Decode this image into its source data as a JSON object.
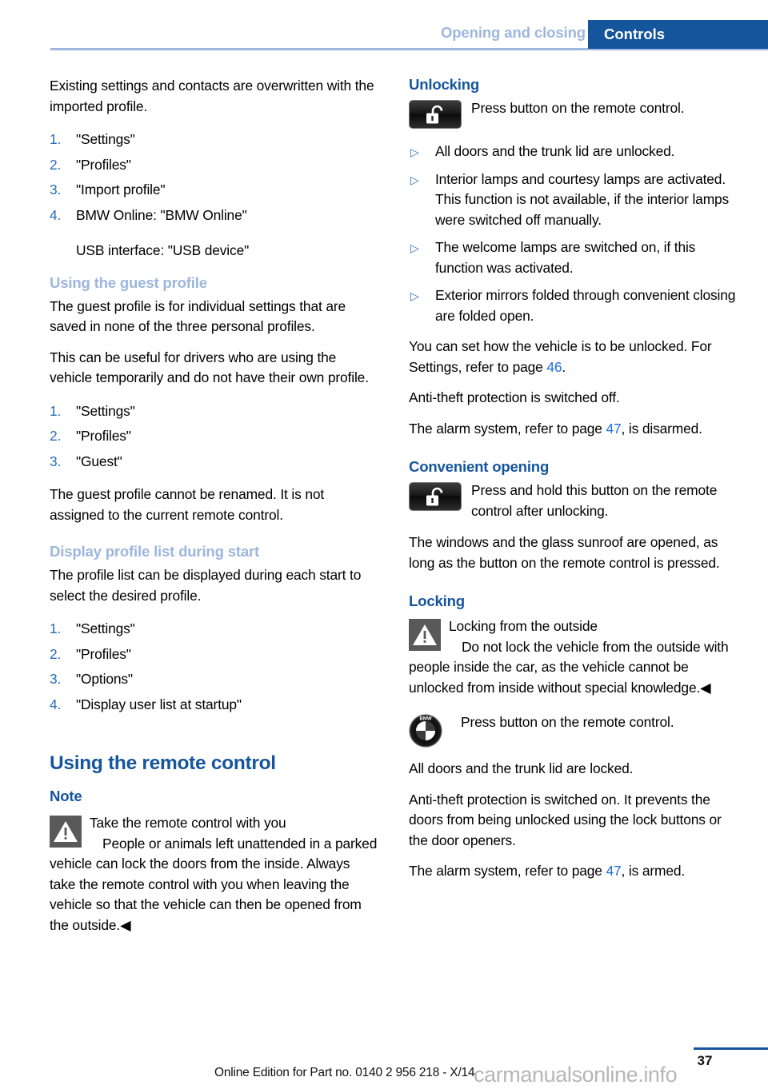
{
  "header": {
    "chapter": "Opening and closing",
    "section": "Controls"
  },
  "left_column": {
    "intro_paragraph": "Existing settings and contacts are overwritten with the imported profile.",
    "import_steps": [
      {
        "num": "1.",
        "text": "\"Settings\""
      },
      {
        "num": "2.",
        "text": "\"Profiles\""
      },
      {
        "num": "3.",
        "text": "\"Import profile\""
      },
      {
        "num": "4.",
        "text": "BMW Online: \"BMW Online\""
      }
    ],
    "import_steps_subline": "USB interface: \"USB device\"",
    "guest_profile": {
      "heading": "Using the guest profile",
      "paragraph_1": "The guest profile is for individual settings that are saved in none of the three personal profiles.",
      "paragraph_2": "This can be useful for drivers who are using the vehicle temporarily and do not have their own profile.",
      "steps": [
        {
          "num": "1.",
          "text": "\"Settings\""
        },
        {
          "num": "2.",
          "text": "\"Profiles\""
        },
        {
          "num": "3.",
          "text": "\"Guest\""
        }
      ],
      "paragraph_3": "The guest profile cannot be renamed. It is not assigned to the current remote control."
    },
    "display_profile_list": {
      "heading": "Display profile list during start",
      "paragraph_1": "The profile list can be displayed during each start to select the desired profile.",
      "steps": [
        {
          "num": "1.",
          "text": "\"Settings\""
        },
        {
          "num": "2.",
          "text": "\"Profiles\""
        },
        {
          "num": "3.",
          "text": "\"Options\""
        },
        {
          "num": "4.",
          "text": "\"Display user list at startup\""
        }
      ]
    },
    "remote_control": {
      "heading": "Using the remote control",
      "note_heading": "Note",
      "warning_title": "Take the remote control with you",
      "warning_body": "People or animals left unattended in a parked vehicle can lock the doors from the inside. Always take the remote control with you when leaving the vehicle so that the vehicle can then be opened from the outside.◀"
    }
  },
  "right_column": {
    "unlocking": {
      "heading": "Unlocking",
      "icon_caption": "Press button on the remote control.",
      "bullets": [
        "All doors and the trunk lid are unlocked.",
        "Interior lamps and courtesy lamps are activated. This function is not available, if the interior lamps were switched off manually.",
        "The welcome lamps are switched on, if this function was activated.",
        "Exterior mirrors folded through convenient closing are folded open."
      ],
      "settings_text_before": "You can set how the vehicle is to be unlocked. For Settings, refer to page ",
      "settings_page_ref": "46",
      "settings_text_after": ".",
      "antitheft_text": "Anti-theft protection is switched off.",
      "alarm_text_before": "The alarm system, refer to page ",
      "alarm_page_ref": "47",
      "alarm_text_after": ", is disarmed."
    },
    "convenient_opening": {
      "heading": "Convenient opening",
      "icon_caption": "Press and hold this button on the remote control after unlocking.",
      "paragraph": "The windows and the glass sunroof are opened, as long as the button on the remote control is pressed."
    },
    "locking": {
      "heading": "Locking",
      "warning_title": "Locking from the outside",
      "warning_body": "Do not lock the vehicle from the outside with people inside the car, as the vehicle cannot be unlocked from inside without special knowledge.◀",
      "bmw_caption": "Press button on the remote control.",
      "paragraph_1": "All doors and the trunk lid are locked.",
      "paragraph_2": "Anti-theft protection is switched on. It prevents the doors from being unlocked using the lock buttons or the door openers.",
      "alarm_text_before": "The alarm system, refer to page ",
      "alarm_page_ref": "47",
      "alarm_text_after": ", is armed."
    }
  },
  "footer": {
    "edition_text": "Online Edition for Part no. 0140 2 956 218 - X/14",
    "page_number": "37",
    "watermark": "carmanualsonline.info"
  },
  "colors": {
    "accent_blue": "#15559c",
    "muted_blue": "#9db6dd",
    "link_blue": "#1f6fe0",
    "list_number_blue": "#2b6cb5"
  },
  "icons": {
    "unlock_button": "unlock-padlock-icon",
    "warning": "warning-triangle-icon",
    "bmw": "bmw-roundel-icon"
  }
}
